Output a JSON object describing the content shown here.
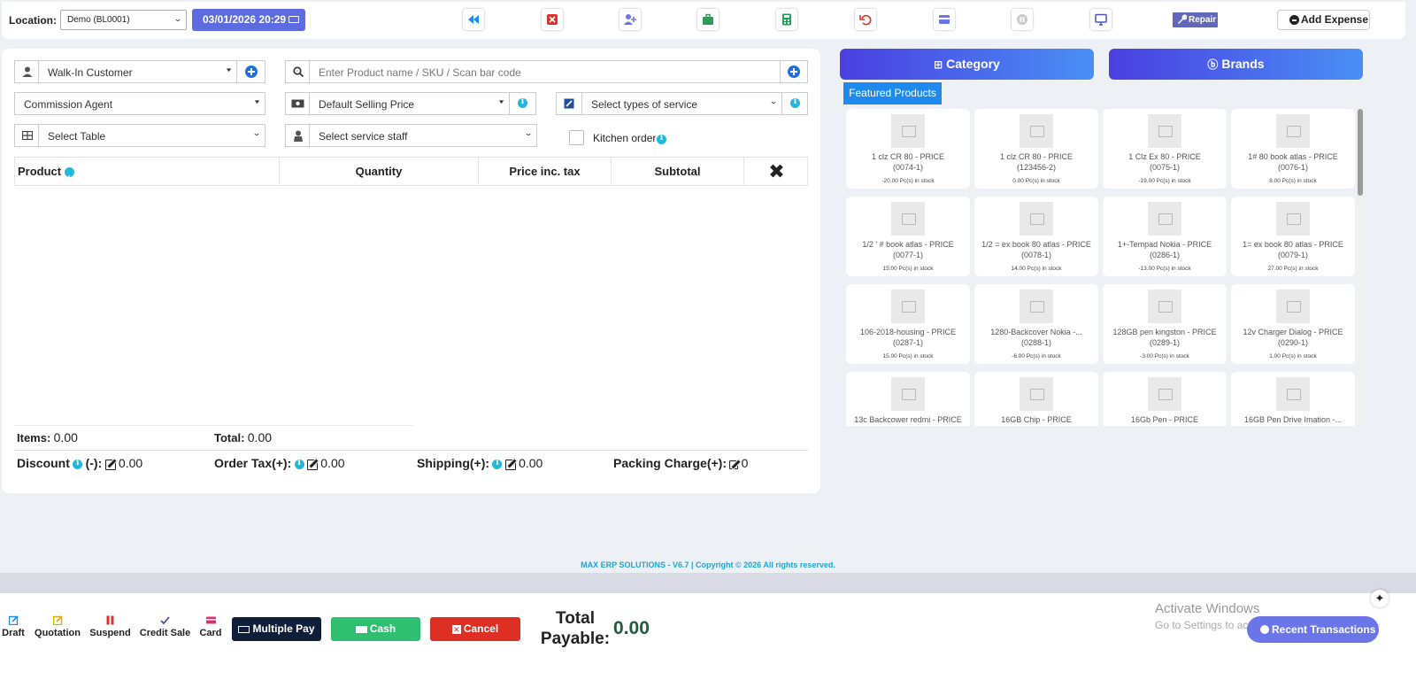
{
  "topbar": {
    "location_label": "Location:",
    "location_value": "Demo (BL0001)",
    "datetime": "03/01/2026 20:29",
    "repair_label": "Repair",
    "add_expense_label": "Add Expense",
    "toolbar_icons": [
      "rewind-icon",
      "close-register-icon",
      "add-user-icon",
      "briefcase-icon",
      "calculator-icon",
      "undo-icon",
      "card-icon",
      "pause-icon",
      "monitor-icon"
    ]
  },
  "form": {
    "customer": "Walk-In Customer",
    "search_placeholder": "Enter Product name / SKU / Scan bar code",
    "commission_agent": "Commission Agent",
    "selling_price": "Default Selling Price",
    "service_types": "Select types of service",
    "table": "Select Table",
    "service_staff": "Select service staff",
    "kitchen_order": "Kitchen order"
  },
  "table": {
    "headers": [
      "Product",
      "Quantity",
      "Price inc. tax",
      "Subtotal"
    ],
    "remove_symbol": "✖"
  },
  "totals": {
    "items_label": "Items:",
    "items_value": "0.00",
    "total_label": "Total:",
    "total_value": "0.00",
    "discount_label": "Discount",
    "discount_sign": "(-):",
    "discount_value": "0.00",
    "order_tax_label": "Order Tax(+):",
    "order_tax_value": "0.00",
    "shipping_label": "Shipping(+):",
    "shipping_value": "0.00",
    "packing_label": "Packing Charge(+):",
    "packing_value": "0"
  },
  "right": {
    "category_label": "Category",
    "brands_label": "Brands",
    "featured_label": "Featured Products",
    "products": [
      {
        "name": "1 clz CR 80 - PRICE",
        "code": "(0074-1)",
        "stock": "-20.00 Pc(s) in stock"
      },
      {
        "name": "1 clz CR 80 - PRICE",
        "code": "(123456-2)",
        "stock": "0.00 Pc(s) in stock"
      },
      {
        "name": "1 Clz Ex 80 - PRICE",
        "code": "(0075-1)",
        "stock": "-19.00 Pc(s) in stock"
      },
      {
        "name": "1# 80 book atlas - PRICE",
        "code": "(0076-1)",
        "stock": "8.00 Pc(s) in stock"
      },
      {
        "name": "1/2 ' # book atlas - PRICE",
        "code": "(0077-1)",
        "stock": "15.00 Pc(s) in stock"
      },
      {
        "name": "1/2 = ex book 80 atlas - PRICE",
        "code": "(0078-1)",
        "stock": "14.00 Pc(s) in stock"
      },
      {
        "name": "1+-Tempad Nokia - PRICE",
        "code": "(0286-1)",
        "stock": "-13.00 Pc(s) in stock"
      },
      {
        "name": "1= ex book 80 atlas - PRICE",
        "code": "(0079-1)",
        "stock": "27.00 Pc(s) in stock"
      },
      {
        "name": "106-2018-housing - PRICE",
        "code": "(0287-1)",
        "stock": "15.00 Pc(s) in stock"
      },
      {
        "name": "1280-Backcover Nokia -...",
        "code": "(0288-1)",
        "stock": "-6.00 Pc(s) in stock"
      },
      {
        "name": "128GB pen kingston - PRICE",
        "code": "(0289-1)",
        "stock": "-3.00 Pc(s) in stock"
      },
      {
        "name": "12v Charger Dialog - PRICE",
        "code": "(0290-1)",
        "stock": "1.00 Pc(s) in stock"
      },
      {
        "name": "13c Backcower redmi - PRICE",
        "code": "",
        "stock": ""
      },
      {
        "name": "16GB Chip - PRICE",
        "code": "",
        "stock": ""
      },
      {
        "name": "16Gb Pen - PRICE",
        "code": "",
        "stock": ""
      },
      {
        "name": "16GB Pen Drive Imation -...",
        "code": "",
        "stock": ""
      }
    ]
  },
  "footer": {
    "copyright": "MAX ERP SOLUTIONS - V6.7 | Copyright © 2026 All rights reserved."
  },
  "bottom": {
    "draft": "Draft",
    "quotation": "Quotation",
    "suspend": "Suspend",
    "credit_sale": "Credit Sale",
    "card": "Card",
    "multiple_pay": "Multiple Pay",
    "cash": "Cash",
    "cancel": "Cancel",
    "total_payable_label": "Total Payable:",
    "total_payable_value": "0.00",
    "activate_title": "Activate Windows",
    "activate_sub": "Go to Settings to activate Windows.",
    "recent_transactions": "Recent Transactions"
  },
  "colors": {
    "accent": "#5c6ce0",
    "cash": "#2fbf71",
    "cancel": "#dd2f24",
    "multiple_pay": "#0f1f3a",
    "featured": "#1e8af0"
  }
}
